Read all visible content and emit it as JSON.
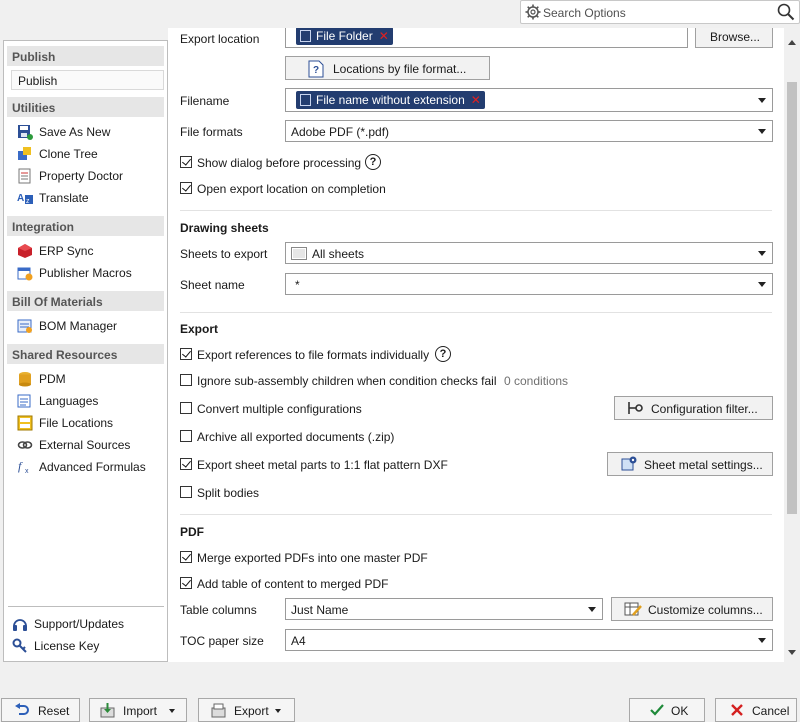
{
  "search": {
    "placeholder": "Search Options"
  },
  "sidebar": {
    "sections": [
      {
        "title": "Publish",
        "items": [
          {
            "label": "Publish"
          }
        ]
      },
      {
        "title": "Utilities",
        "items": [
          {
            "label": "Save As New",
            "icon": "save-as-new-icon"
          },
          {
            "label": "Clone Tree",
            "icon": "clone-tree-icon"
          },
          {
            "label": "Property Doctor",
            "icon": "property-doctor-icon"
          },
          {
            "label": "Translate",
            "icon": "translate-icon"
          }
        ]
      },
      {
        "title": "Integration",
        "items": [
          {
            "label": "ERP Sync",
            "icon": "erp-sync-icon"
          },
          {
            "label": "Publisher Macros",
            "icon": "publisher-macros-icon"
          }
        ]
      },
      {
        "title": "Bill Of Materials",
        "items": [
          {
            "label": "BOM Manager",
            "icon": "bom-manager-icon"
          }
        ]
      },
      {
        "title": "Shared Resources",
        "items": [
          {
            "label": "PDM",
            "icon": "pdm-icon"
          },
          {
            "label": "Languages",
            "icon": "languages-icon"
          },
          {
            "label": "File Locations",
            "icon": "file-locations-icon"
          },
          {
            "label": "External Sources",
            "icon": "external-sources-icon"
          },
          {
            "label": "Advanced Formulas",
            "icon": "advanced-formulas-icon"
          }
        ]
      }
    ],
    "footer": [
      {
        "label": "Support/Updates",
        "icon": "headset-icon"
      },
      {
        "label": "License Key",
        "icon": "key-icon"
      }
    ]
  },
  "main": {
    "export_location": {
      "label": "Export location",
      "token": "File Folder",
      "browse": "Browse..."
    },
    "locations_button": "Locations by file format...",
    "filename": {
      "label": "Filename",
      "token": "File name without extension"
    },
    "file_formats": {
      "label": "File formats",
      "value": "Adobe PDF (*.pdf)"
    },
    "show_dialog": {
      "label": "Show dialog before processing",
      "checked": true
    },
    "open_location": {
      "label": "Open export location on completion",
      "checked": true
    },
    "drawing": {
      "heading": "Drawing sheets",
      "sheets_label": "Sheets to export",
      "sheets_value": "All sheets",
      "name_label": "Sheet name",
      "name_value": "*"
    },
    "export": {
      "heading": "Export",
      "refs": {
        "label": "Export references to file formats individually",
        "checked": true
      },
      "ignore": {
        "label": "Ignore sub-assembly children when condition checks fail",
        "checked": false,
        "conditions": "0 conditions"
      },
      "convert": {
        "label": "Convert multiple configurations",
        "checked": false,
        "button": "Configuration filter..."
      },
      "archive": {
        "label": "Archive all exported documents (.zip)",
        "checked": false
      },
      "sheetmetal": {
        "label": "Export sheet metal parts to 1:1 flat pattern DXF",
        "checked": true,
        "button": "Sheet metal settings..."
      },
      "split": {
        "label": "Split bodies",
        "checked": false
      }
    },
    "pdf": {
      "heading": "PDF",
      "merge": {
        "label": "Merge exported PDFs into one master PDF",
        "checked": true
      },
      "toc": {
        "label": "Add table of content to merged PDF",
        "checked": true
      },
      "columns_label": "Table columns",
      "columns_value": "Just Name",
      "customize": "Customize columns...",
      "paper_label": "TOC paper size",
      "paper_value": "A4"
    }
  },
  "bottom": {
    "reset": "Reset",
    "import": "Import",
    "export": "Export",
    "ok": "OK",
    "cancel": "Cancel"
  },
  "colors": {
    "token_bg": "#233d70",
    "remove_x": "#e02020",
    "ok_check": "#1f8a3a",
    "cancel_x": "#d42020"
  }
}
